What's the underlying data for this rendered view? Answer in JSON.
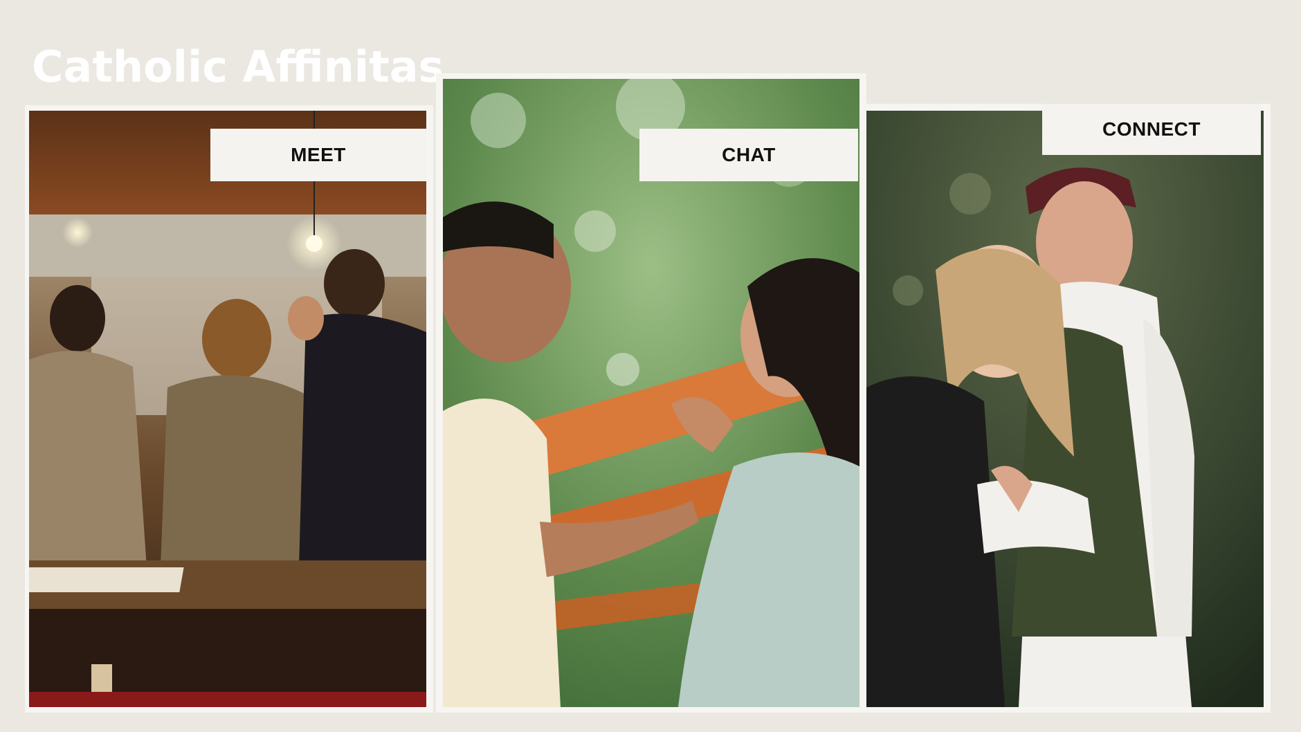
{
  "brand": {
    "title": "Catholic Affinitas"
  },
  "panels": [
    {
      "label": "MEET",
      "photo": "social-gathering-photo"
    },
    {
      "label": "CHAT",
      "photo": "laughing-couple-photo"
    },
    {
      "label": "CONNECT",
      "photo": "embracing-couple-photo"
    }
  ],
  "colors": {
    "background": "#ebe8e2",
    "frame": "#f6f5f1",
    "label_box": "#f4f3ef",
    "label_text": "#111111",
    "title_text": "#ffffff"
  }
}
